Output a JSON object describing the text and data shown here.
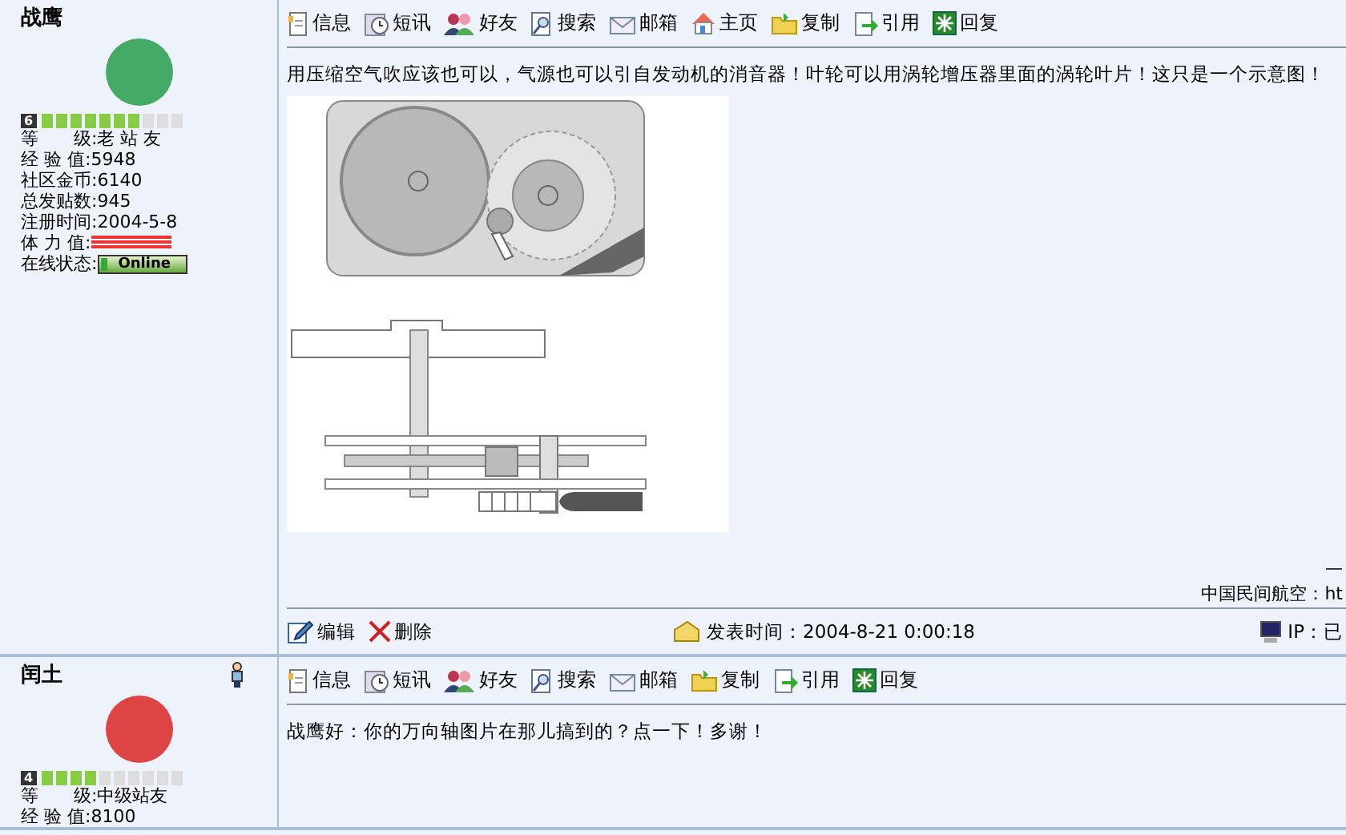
{
  "posts": [
    {
      "author": "战鹰",
      "level_badge": "6",
      "level": 0.7,
      "stats": [
        {
          "kind": "text",
          "label": "等　　级:",
          "value": "老 站 友"
        },
        {
          "kind": "text",
          "label": "经 验 值:",
          "value": "5948"
        },
        {
          "kind": "text",
          "label": "社区金币:",
          "value": "6140"
        },
        {
          "kind": "text",
          "label": "总发贴数:",
          "value": "945"
        },
        {
          "kind": "text",
          "label": "注册时间:",
          "value": "2004-5-8"
        },
        {
          "kind": "stamina",
          "label": "体 力 值:"
        },
        {
          "kind": "online",
          "label": "在线状态:",
          "value": "Online"
        }
      ],
      "toolbar": [
        {
          "kind": "info",
          "label": "信息"
        },
        {
          "kind": "message",
          "label": "短讯"
        },
        {
          "kind": "friends",
          "label": "好友"
        },
        {
          "kind": "search",
          "label": "搜索"
        },
        {
          "kind": "mail",
          "label": "邮箱"
        },
        {
          "kind": "home",
          "label": "主页"
        },
        {
          "kind": "copy",
          "label": "复制"
        },
        {
          "kind": "quote",
          "label": "引用"
        },
        {
          "kind": "reply",
          "label": "回复"
        }
      ],
      "body": "用压缩空气吹应该也可以，气源也可以引自发动机的消音器！叶轮可以用涡轮增压器里面的涡轮叶片！这只是一个示意图！",
      "image": {
        "kind": "diagram"
      },
      "signature": [
        "—",
        "中国民间航空：ht"
      ],
      "footer": {
        "actions": [
          {
            "kind": "edit",
            "label": "编辑"
          },
          {
            "kind": "delete",
            "label": "删除"
          }
        ],
        "time": "发表时间：2004-8-21 0:00:18",
        "ip": "IP：已"
      }
    },
    {
      "author": "闰土",
      "author_icon": {
        "kind": "person"
      },
      "level_badge": "4",
      "level": 0.4,
      "stats": [
        {
          "kind": "text",
          "label": "等　　级:",
          "value": "中级站友"
        },
        {
          "kind": "text",
          "label": "经 验 值:",
          "value": "8100"
        }
      ],
      "toolbar": [
        {
          "kind": "info",
          "label": "信息"
        },
        {
          "kind": "message",
          "label": "短讯"
        },
        {
          "kind": "friends",
          "label": "好友"
        },
        {
          "kind": "search",
          "label": "搜索"
        },
        {
          "kind": "mail",
          "label": "邮箱"
        },
        {
          "kind": "copy",
          "label": "复制"
        },
        {
          "kind": "quote",
          "label": "引用"
        },
        {
          "kind": "reply",
          "label": "回复"
        }
      ],
      "body": "战鹰好：你的万向轴图片在那儿搞到的？点一下！多谢！"
    }
  ]
}
